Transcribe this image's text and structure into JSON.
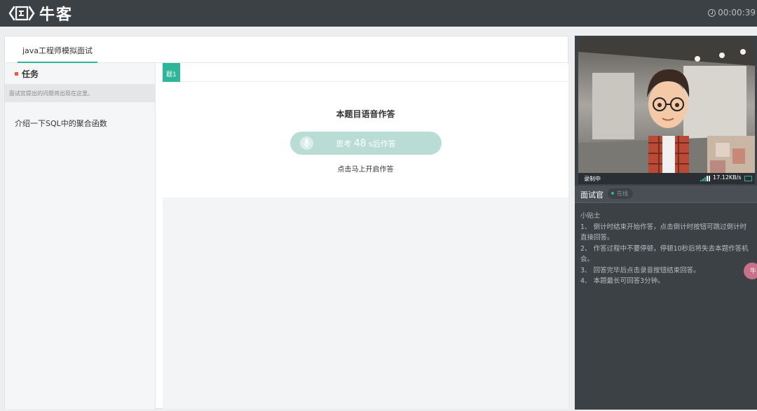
{
  "header": {
    "logo_text": "牛客",
    "timer": "00:00:39"
  },
  "tabs": [
    {
      "label": "java工程师模拟面试",
      "active": true
    }
  ],
  "task": {
    "title": "任务",
    "hint": "面试官提出的问题将出现在这里。",
    "question": "介绍一下SQL中的聚合函数"
  },
  "question_panel": {
    "tab_label": "题1",
    "heading": "本题目语音作答",
    "voice_button": {
      "prefix": "思考",
      "seconds": "48",
      "suffix": "s后作答"
    },
    "start_link": "点击马上开启作答"
  },
  "interviewer": {
    "recording_label": "录制中",
    "network_speed": "17.12KB/s",
    "title": "面试官",
    "status": "在线",
    "tips_title": "小贴士",
    "tips": [
      "1、 倒计时结束开始作答，点击倒计时按钮可跳过倒计时直接回答。",
      "2、 作答过程中不要停顿，停顿10秒后将失去本题作答机会。",
      "3、 回答完毕后点击录音按钮结束回答。",
      "4、 本题最长可回答3分钟。"
    ]
  },
  "float_button": {
    "label": "牛"
  },
  "colors": {
    "accent": "#2fb69a",
    "topbar": "#3c4146",
    "task_marker": "#f05a3a"
  }
}
